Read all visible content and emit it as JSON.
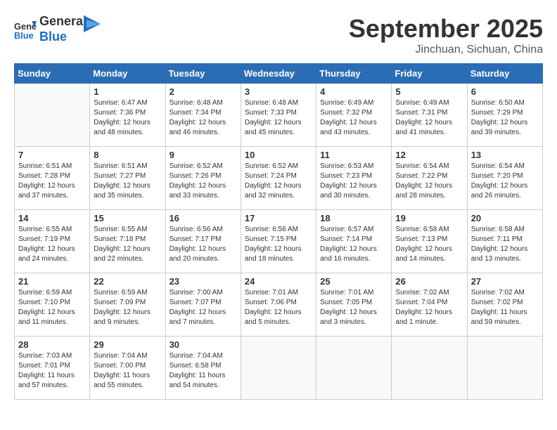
{
  "header": {
    "logo_line1": "General",
    "logo_line2": "Blue",
    "month": "September 2025",
    "location": "Jinchuan, Sichuan, China"
  },
  "days_of_week": [
    "Sunday",
    "Monday",
    "Tuesday",
    "Wednesday",
    "Thursday",
    "Friday",
    "Saturday"
  ],
  "weeks": [
    [
      {
        "day": "",
        "info": ""
      },
      {
        "day": "1",
        "info": "Sunrise: 6:47 AM\nSunset: 7:36 PM\nDaylight: 12 hours\nand 48 minutes."
      },
      {
        "day": "2",
        "info": "Sunrise: 6:48 AM\nSunset: 7:34 PM\nDaylight: 12 hours\nand 46 minutes."
      },
      {
        "day": "3",
        "info": "Sunrise: 6:48 AM\nSunset: 7:33 PM\nDaylight: 12 hours\nand 45 minutes."
      },
      {
        "day": "4",
        "info": "Sunrise: 6:49 AM\nSunset: 7:32 PM\nDaylight: 12 hours\nand 43 minutes."
      },
      {
        "day": "5",
        "info": "Sunrise: 6:49 AM\nSunset: 7:31 PM\nDaylight: 12 hours\nand 41 minutes."
      },
      {
        "day": "6",
        "info": "Sunrise: 6:50 AM\nSunset: 7:29 PM\nDaylight: 12 hours\nand 39 minutes."
      }
    ],
    [
      {
        "day": "7",
        "info": "Sunrise: 6:51 AM\nSunset: 7:28 PM\nDaylight: 12 hours\nand 37 minutes."
      },
      {
        "day": "8",
        "info": "Sunrise: 6:51 AM\nSunset: 7:27 PM\nDaylight: 12 hours\nand 35 minutes."
      },
      {
        "day": "9",
        "info": "Sunrise: 6:52 AM\nSunset: 7:26 PM\nDaylight: 12 hours\nand 33 minutes."
      },
      {
        "day": "10",
        "info": "Sunrise: 6:52 AM\nSunset: 7:24 PM\nDaylight: 12 hours\nand 32 minutes."
      },
      {
        "day": "11",
        "info": "Sunrise: 6:53 AM\nSunset: 7:23 PM\nDaylight: 12 hours\nand 30 minutes."
      },
      {
        "day": "12",
        "info": "Sunrise: 6:54 AM\nSunset: 7:22 PM\nDaylight: 12 hours\nand 28 minutes."
      },
      {
        "day": "13",
        "info": "Sunrise: 6:54 AM\nSunset: 7:20 PM\nDaylight: 12 hours\nand 26 minutes."
      }
    ],
    [
      {
        "day": "14",
        "info": "Sunrise: 6:55 AM\nSunset: 7:19 PM\nDaylight: 12 hours\nand 24 minutes."
      },
      {
        "day": "15",
        "info": "Sunrise: 6:55 AM\nSunset: 7:18 PM\nDaylight: 12 hours\nand 22 minutes."
      },
      {
        "day": "16",
        "info": "Sunrise: 6:56 AM\nSunset: 7:17 PM\nDaylight: 12 hours\nand 20 minutes."
      },
      {
        "day": "17",
        "info": "Sunrise: 6:56 AM\nSunset: 7:15 PM\nDaylight: 12 hours\nand 18 minutes."
      },
      {
        "day": "18",
        "info": "Sunrise: 6:57 AM\nSunset: 7:14 PM\nDaylight: 12 hours\nand 16 minutes."
      },
      {
        "day": "19",
        "info": "Sunrise: 6:58 AM\nSunset: 7:13 PM\nDaylight: 12 hours\nand 14 minutes."
      },
      {
        "day": "20",
        "info": "Sunrise: 6:58 AM\nSunset: 7:11 PM\nDaylight: 12 hours\nand 13 minutes."
      }
    ],
    [
      {
        "day": "21",
        "info": "Sunrise: 6:59 AM\nSunset: 7:10 PM\nDaylight: 12 hours\nand 11 minutes."
      },
      {
        "day": "22",
        "info": "Sunrise: 6:59 AM\nSunset: 7:09 PM\nDaylight: 12 hours\nand 9 minutes."
      },
      {
        "day": "23",
        "info": "Sunrise: 7:00 AM\nSunset: 7:07 PM\nDaylight: 12 hours\nand 7 minutes."
      },
      {
        "day": "24",
        "info": "Sunrise: 7:01 AM\nSunset: 7:06 PM\nDaylight: 12 hours\nand 5 minutes."
      },
      {
        "day": "25",
        "info": "Sunrise: 7:01 AM\nSunset: 7:05 PM\nDaylight: 12 hours\nand 3 minutes."
      },
      {
        "day": "26",
        "info": "Sunrise: 7:02 AM\nSunset: 7:04 PM\nDaylight: 12 hours\nand 1 minute."
      },
      {
        "day": "27",
        "info": "Sunrise: 7:02 AM\nSunset: 7:02 PM\nDaylight: 11 hours\nand 59 minutes."
      }
    ],
    [
      {
        "day": "28",
        "info": "Sunrise: 7:03 AM\nSunset: 7:01 PM\nDaylight: 11 hours\nand 57 minutes."
      },
      {
        "day": "29",
        "info": "Sunrise: 7:04 AM\nSunset: 7:00 PM\nDaylight: 11 hours\nand 55 minutes."
      },
      {
        "day": "30",
        "info": "Sunrise: 7:04 AM\nSunset: 6:58 PM\nDaylight: 11 hours\nand 54 minutes."
      },
      {
        "day": "",
        "info": ""
      },
      {
        "day": "",
        "info": ""
      },
      {
        "day": "",
        "info": ""
      },
      {
        "day": "",
        "info": ""
      }
    ]
  ]
}
